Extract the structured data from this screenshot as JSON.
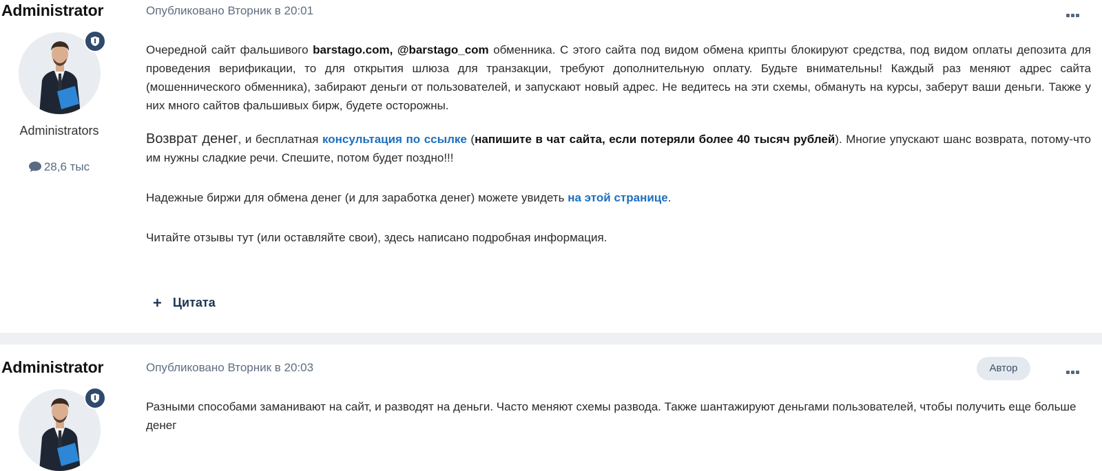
{
  "posts": [
    {
      "author": "Administrator",
      "group": "Administrators",
      "post_count": "28,6 тыс",
      "published": "Опубликовано Вторник в 20:01",
      "menu_icon": "ellipsis-icon",
      "paragraphs": {
        "p1": {
          "t1": "Очередной сайт фальшивого ",
          "b1": "barstago.com, @barstago_com",
          "t2": " обменника. С этого сайта под видом обмена крипты блокируют средства, под видом оплаты депозита для проведения верификации, то для открытия шлюза для транзакции, требуют дополнительную оплату. Будьте внимательны! Каждый раз меняют адрес сайта (мошеннического обменника), забирают деньги от пользователей, и запускают новый адрес. Не ведитесь на эти схемы, обмануть на курсы, заберут ваши деньги. Также у них много сайтов фальшивых бирж, будете осторожны."
        },
        "p2": {
          "big": "Возврат денег",
          "t1": ", и бесплатная ",
          "link": "консультация по ссылке",
          "t2": "  (",
          "b1": "напишите в чат сайта, если потеряли более 40 тысяч рублей",
          "t3": "). Многие упускают шанс возврата, потому-что им нужны сладкие речи. Спешите, потом будет поздно!!!"
        },
        "p3": {
          "t1": "Надежные биржи для обмена денег (и для заработка денег) можете увидеть ",
          "link": "на этой странице",
          "t2": "."
        },
        "p4": {
          "t1": "Читайте отзывы тут (или оставляйте свои), здесь написано подробная информация."
        }
      },
      "quote_label": "Цитата"
    },
    {
      "author": "Administrator",
      "published": "Опубликовано Вторник в 20:03",
      "author_badge": "Автор",
      "menu_icon": "ellipsis-icon",
      "text": "Разными способами заманивают на сайт, и разводят на деньги. Часто меняют схемы развода. Также шантажируют деньгами пользователей, чтобы получить еще больше денег"
    }
  ],
  "colors": {
    "link": "#1d6fbd",
    "meta": "#5f6d80",
    "separator": "#eef0f4",
    "badge": "#2f4a6b"
  }
}
